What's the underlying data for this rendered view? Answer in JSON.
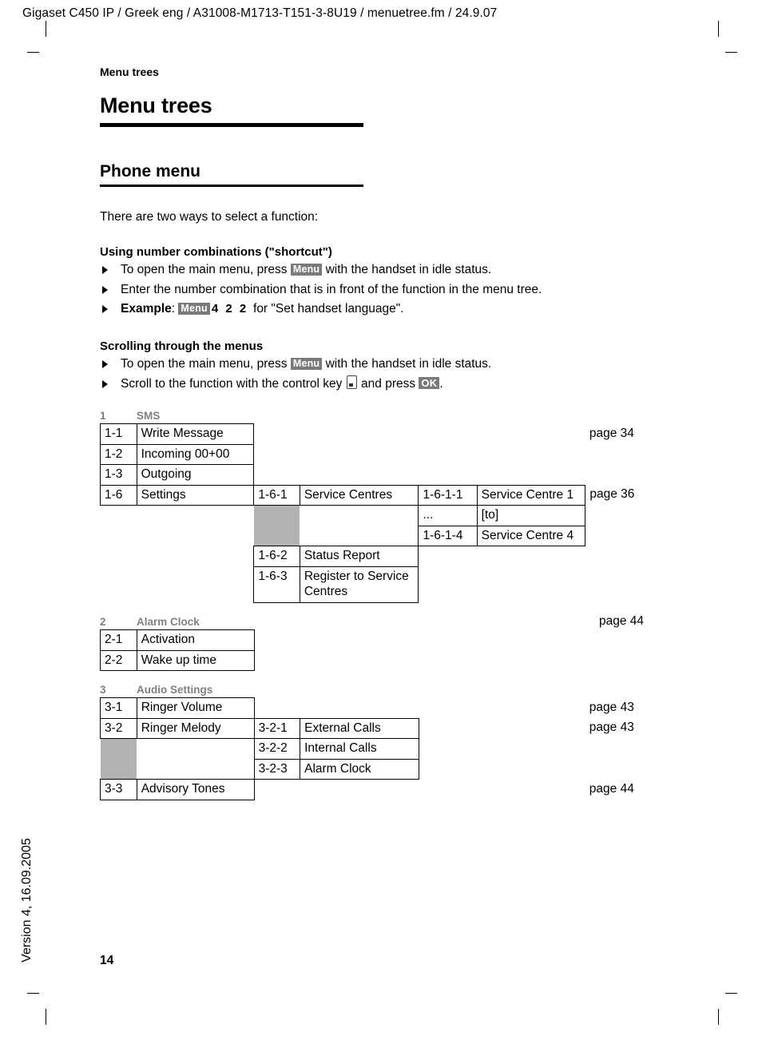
{
  "document": {
    "header_line": "Gigaset C450 IP / Greek eng / A31008-M1713-T151-3-8U19 / menuetree.fm / 24.9.07",
    "running_head": "Menu trees",
    "version_sidebar": "Version 4, 16.09.2005",
    "page_number": "14"
  },
  "title": "Menu trees",
  "subtitle": "Phone menu",
  "intro": "There are two ways to select a function:",
  "shortcut_block": {
    "heading": "Using number combinations (\"shortcut\")",
    "items": [
      {
        "prefix": "To open the main menu, press ",
        "badge": "Menu",
        "suffix": " with the handset in idle status."
      },
      {
        "prefix": "Enter the number combination that is in front of the function in the menu tree.",
        "badge": "",
        "suffix": ""
      }
    ],
    "example": {
      "label": "Example",
      "colon": ": ",
      "badge": "Menu",
      "digits": "4 2 2",
      "suffix": " for \"Set handset language\"."
    }
  },
  "scrolling_block": {
    "heading": "Scrolling through the menus",
    "item1": {
      "prefix": "To open the main menu, press ",
      "badge": "Menu",
      "suffix": " with the handset in idle status."
    },
    "item2": {
      "prefix": "Scroll to the function with the control key ",
      "mid": " and press ",
      "badge": "OK",
      "suffix": "."
    }
  },
  "sections": [
    {
      "number": "1",
      "name": "SMS",
      "page": "",
      "rows": [
        {
          "id": "1-1",
          "name": "Write Message",
          "page": "page 34"
        },
        {
          "id": "1-2",
          "name": "Incoming 00+00",
          "page": ""
        },
        {
          "id": "1-3",
          "name": "Outgoing",
          "page": ""
        },
        {
          "id": "1-6",
          "name": "Settings",
          "sub_id": "1-6-1",
          "sub_name": "Service Centres",
          "sub2_id": "1-6-1-1",
          "sub2_name": "Service Centre 1",
          "page": "page 36"
        },
        {
          "sub2_id": "...",
          "sub2_name": "[to]"
        },
        {
          "sub2_id": "1-6-1-4",
          "sub2_name": "Service Centre 4"
        },
        {
          "sub_id": "1-6-2",
          "sub_name": "Status Report"
        },
        {
          "sub_id": "1-6-3",
          "sub_name": "Register to Service Centres"
        }
      ]
    },
    {
      "number": "2",
      "name": "Alarm Clock",
      "page": "page 44",
      "rows": [
        {
          "id": "2-1",
          "name": "Activation"
        },
        {
          "id": "2-2",
          "name": "Wake up time"
        }
      ]
    },
    {
      "number": "3",
      "name": "Audio Settings",
      "page": "",
      "rows": [
        {
          "id": "3-1",
          "name": "Ringer Volume",
          "page": "page 43"
        },
        {
          "id": "3-2",
          "name": "Ringer Melody",
          "sub_id": "3-2-1",
          "sub_name": "External Calls",
          "page": "page 43"
        },
        {
          "sub_id": "3-2-2",
          "sub_name": "Internal Calls"
        },
        {
          "sub_id": "3-2-3",
          "sub_name": "Alarm Clock"
        },
        {
          "id": "3-3",
          "name": "Advisory Tones",
          "page": "page 44"
        }
      ]
    }
  ]
}
